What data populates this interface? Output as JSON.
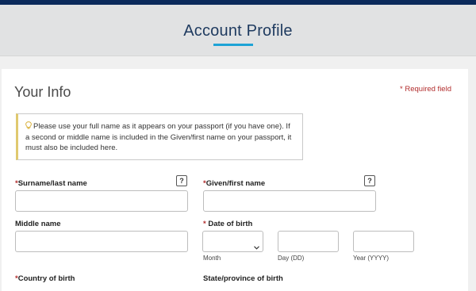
{
  "header": {
    "title": "Account Profile"
  },
  "section": {
    "title": "Your Info",
    "required_note": "* Required field"
  },
  "notice": {
    "icon": "lightbulb-icon",
    "text": "Please use your full name as it appears on your passport (if you have one). If a second or middle name is included in the Given/first name on your passport, it must also be included here."
  },
  "fields": {
    "surname": {
      "star": "*",
      "label": "Surname/last name",
      "help": "?",
      "value": ""
    },
    "given": {
      "star": "*",
      "label": "Given/first name",
      "help": "?",
      "value": ""
    },
    "middle": {
      "label": "Middle name",
      "value": ""
    },
    "dob": {
      "star": "* ",
      "label": "Date of birth",
      "month_label": "Month",
      "day_label": "Day (DD)",
      "year_label": "Year (YYYY)",
      "month_value": "",
      "day_value": "",
      "year_value": ""
    },
    "country": {
      "star": "*",
      "label": "Country of birth"
    },
    "state": {
      "label": "State/province of birth"
    }
  },
  "colors": {
    "accent": "#1ea3d6",
    "navy": "#0b2a5b",
    "required": "#b22e2e"
  }
}
